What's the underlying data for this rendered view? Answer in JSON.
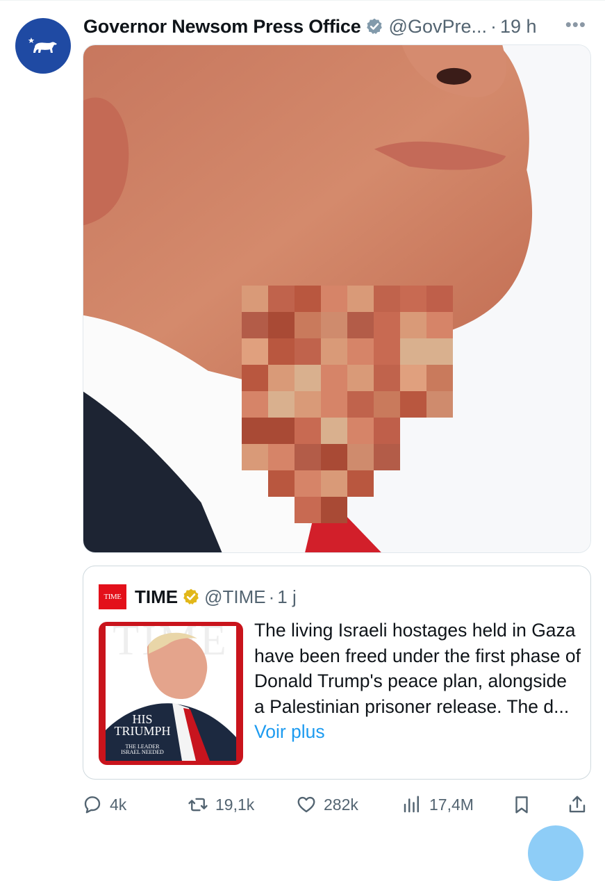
{
  "post": {
    "author_name": "Governor Newsom Press Office",
    "handle": "@GovPre...",
    "separator": "·",
    "time": "19 h",
    "more_icon": "more-icon",
    "avatar_icon": "california-bear-icon",
    "colors": {
      "avatar_bg": "#1f4aa3",
      "verified": "#829aab"
    }
  },
  "quote": {
    "logo_text": "TIME",
    "author_name": "TIME",
    "handle": "@TIME",
    "separator": "·",
    "time": "1 j",
    "text": "The living Israeli hostages held in Gaza have been freed under the first phase of Donald Trump's peace plan, alongside a Palestinian prisoner release. The d...",
    "see_more": "Voir plus",
    "cover": {
      "title_line1": "HIS",
      "title_line2": "TRIUMPH",
      "subtitle_line1": "THE LEADER",
      "subtitle_line2": "ISRAEL NEEDED"
    },
    "colors": {
      "link": "#1d9bf0",
      "gold_check": "#e2b719",
      "time_red": "#e3101a"
    }
  },
  "actions": {
    "replies": "4k",
    "reposts": "19,1k",
    "likes": "282k",
    "views": "17,4M"
  }
}
